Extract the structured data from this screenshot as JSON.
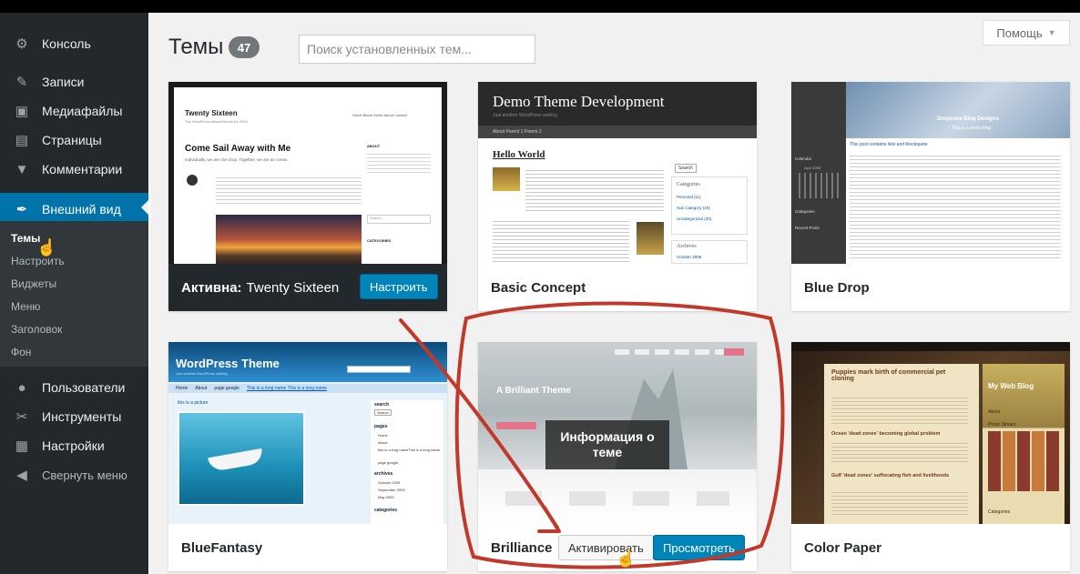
{
  "sidebar": {
    "items": [
      {
        "label": "Консоль",
        "icon": "dashboard-icon"
      },
      {
        "label": "Записи",
        "icon": "pin-icon"
      },
      {
        "label": "Медиафайлы",
        "icon": "media-icon"
      },
      {
        "label": "Страницы",
        "icon": "pages-icon"
      },
      {
        "label": "Комментарии",
        "icon": "comments-icon"
      },
      {
        "label": "Внешний вид",
        "icon": "brush-icon",
        "active": true
      },
      {
        "label": "Пользователи",
        "icon": "users-icon"
      },
      {
        "label": "Инструменты",
        "icon": "tools-icon"
      },
      {
        "label": "Настройки",
        "icon": "settings-icon"
      },
      {
        "label": "Свернуть меню",
        "icon": "collapse-icon"
      }
    ],
    "submenu": [
      "Темы",
      "Настроить",
      "Виджеты",
      "Меню",
      "Заголовок",
      "Фон"
    ]
  },
  "header": {
    "title": "Темы",
    "count": "47",
    "search_placeholder": "Поиск установленных тем...",
    "help_label": "Помощь"
  },
  "themes": [
    {
      "name": "Twenty Sixteen",
      "active_prefix": "Активна:",
      "customize_label": "Настроить",
      "shot": {
        "site_title": "Twenty Sixteen",
        "tagline": "The WordPress default theme for 2016",
        "nav": "Home   Blank Guide   About   Contact",
        "post_title": "Come Sail Away with Me",
        "post_lead": "Individually, we are one drop. Together, we are an ocean.",
        "widget_about": "ABOUT",
        "widget_categories": "CATEGORIES",
        "search_placeholder": "Search..."
      }
    },
    {
      "name": "Basic Concept",
      "shot": {
        "site_title": "Demo Theme Development",
        "tagline": "Just another WordPress weblog",
        "nav": "About   Parent 1   Parent 2",
        "post_title": "Hello World",
        "search_btn": "Search",
        "widget_categories": "Categories",
        "cat_items": [
          "Personal (11)",
          "Sub Category (10)",
          "Uncategorized (20)"
        ],
        "widget_archives": "Archives",
        "archive_item": "October 2006"
      }
    },
    {
      "name": "Blue Drop",
      "shot": {
        "banner_title": "Dropzone Blog Designs",
        "banner_sub": "This is a demo blog",
        "post_title": "This post contains lists and blockquote",
        "side_calendar": "Calendar",
        "side_month": "April 2008",
        "side_categories": "Categories",
        "side_recent": "Recent Posts"
      }
    },
    {
      "name": "BlueFantasy",
      "shot": {
        "site_title": "WordPress Theme",
        "tagline": "Just another WordPress weblog",
        "nav": [
          "Home",
          "About",
          "page google",
          "This is a long name This is a long name"
        ],
        "post_title": "this is a picture",
        "widget_search": "search",
        "search_btn": "Search",
        "widget_pages": "pages",
        "pages_items": [
          "Home",
          "About",
          "this is a long nameThis is a long name",
          "page google"
        ],
        "widget_archives": "archives",
        "archive_items": [
          "October 2009",
          "September 2009",
          "May 2009"
        ],
        "widget_categories": "categories"
      }
    },
    {
      "name": "Brilliance",
      "activate_label": "Активировать",
      "preview_label": "Просмотреть",
      "info_overlay": "Информация о теме",
      "shot": {
        "hero_title": "A Brilliant Theme"
      }
    },
    {
      "name": "Color Paper",
      "shot": {
        "site_title": "My Web Blog",
        "post1_title": "Puppies mark birth of commercial pet cloning",
        "post2_title": "Ocean 'dead zones' becoming global problem",
        "post3_title": "Gulf 'dead zones' suffocating fish and livelihoods",
        "side_about": "About",
        "side_photos": "Photo Stream",
        "side_categories": "Categories"
      }
    }
  ],
  "colors": {
    "sidebar_bg": "#23282d",
    "accent": "#0073aa",
    "button_primary": "#0085ba",
    "annotation_red": "#c0392b"
  }
}
